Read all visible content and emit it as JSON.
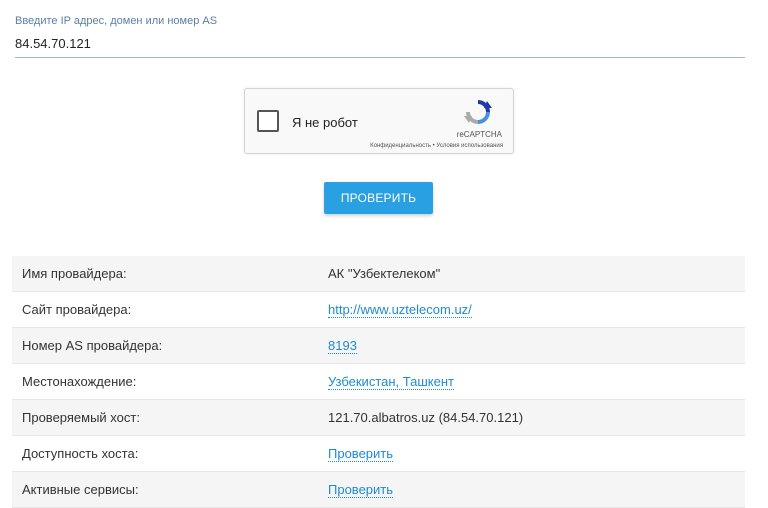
{
  "form": {
    "label": "Введите IP адрес, домен или номер AS",
    "value": "84.54.70.121"
  },
  "recaptcha": {
    "label": "Я не робот",
    "brand": "reCAPTCHA",
    "terms": "Конфиденциальность • Условия использования",
    "icon": "recaptcha-logo-icon"
  },
  "check_button": {
    "label": "ПРОВЕРИТЬ",
    "color": "#29a0e2"
  },
  "info": {
    "rows": [
      {
        "key": "Имя провайдера:",
        "value": "АК \"Узбектелеком\"",
        "link": false
      },
      {
        "key": "Сайт провайдера:",
        "value": "http://www.uztelecom.uz/",
        "link": true
      },
      {
        "key": "Номер AS провайдера:",
        "value": "8193",
        "link": true
      },
      {
        "key": "Местонахождение:",
        "value": "Узбекистан, Ташкент",
        "link": true
      },
      {
        "key": "Проверяемый хост:",
        "value": "121.70.albatros.uz (84.54.70.121)",
        "link": false
      },
      {
        "key": "Доступность хоста:",
        "value": "Проверить",
        "link": true
      },
      {
        "key": "Активные сервисы:",
        "value": "Проверить",
        "link": true
      }
    ]
  }
}
